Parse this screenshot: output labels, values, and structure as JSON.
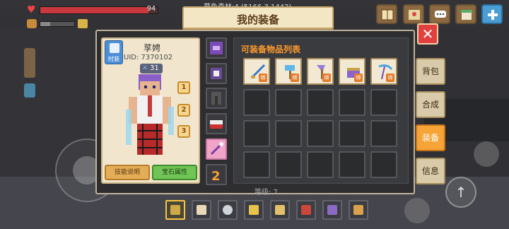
{
  "hud": {
    "hp_value": "94",
    "hp_fraction": 0.92,
    "location": "莫鱼森林:4 (5166,3,1442)"
  },
  "header": {
    "title": "我的装备"
  },
  "character": {
    "name": "莩娉",
    "uid": "UID: 7370102",
    "power": "31",
    "fashion_label": "时装",
    "slot_numbers": [
      "1",
      "2",
      "3"
    ],
    "skill_button": "技能说明",
    "gem_button": "宝石属性"
  },
  "inventory": {
    "title": "可装备物品列表",
    "bind_badge": "绑",
    "items": [
      "sword-icon",
      "hammer-icon",
      "axe-icon",
      "chest-icon",
      "scythe-icon"
    ]
  },
  "tabs": [
    {
      "label": "背包",
      "active": false
    },
    {
      "label": "合成",
      "active": false
    },
    {
      "label": "装备",
      "active": true
    },
    {
      "label": "信息",
      "active": false
    }
  ],
  "close_label": "✕",
  "footer": {
    "level_text": "等级: 7"
  },
  "colors": {
    "accent": "#f6a437",
    "title_orange": "#ff9a2e",
    "close_red": "#e2403f"
  }
}
